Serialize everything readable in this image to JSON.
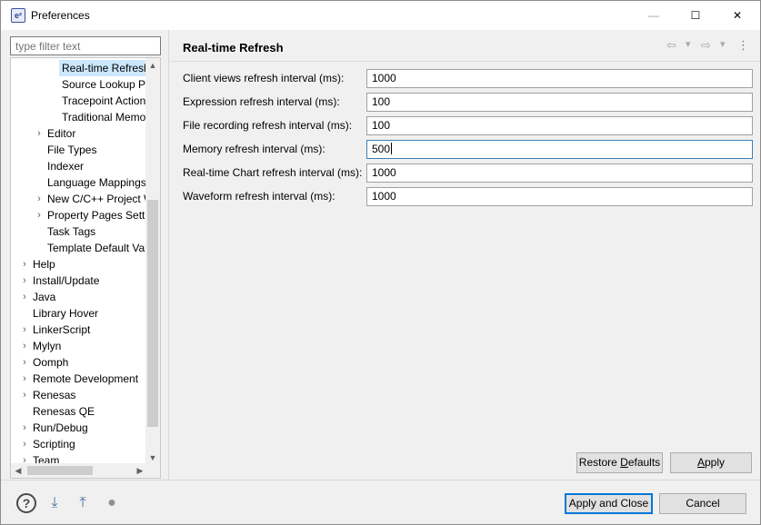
{
  "window": {
    "title": "Preferences",
    "app_icon_glyph": "e²",
    "minimize_glyph": "—",
    "maximize_glyph": "☐",
    "close_glyph": "✕"
  },
  "filter": {
    "placeholder": "type filter text"
  },
  "tree": {
    "expand_glyph": "›",
    "items": [
      {
        "label": "Real-time Refresh",
        "level": 3,
        "expandable": false,
        "selected": true
      },
      {
        "label": "Source Lookup Pa",
        "level": 3,
        "expandable": false,
        "selected": false
      },
      {
        "label": "Tracepoint Actions",
        "level": 3,
        "expandable": false,
        "selected": false
      },
      {
        "label": "Traditional Memor",
        "level": 3,
        "expandable": false,
        "selected": false
      },
      {
        "label": "Editor",
        "level": 2,
        "expandable": true,
        "selected": false
      },
      {
        "label": "File Types",
        "level": 2,
        "expandable": false,
        "selected": false
      },
      {
        "label": "Indexer",
        "level": 2,
        "expandable": false,
        "selected": false
      },
      {
        "label": "Language Mappings",
        "level": 2,
        "expandable": false,
        "selected": false
      },
      {
        "label": "New C/C++ Project W",
        "level": 2,
        "expandable": true,
        "selected": false
      },
      {
        "label": "Property Pages Settin",
        "level": 2,
        "expandable": true,
        "selected": false
      },
      {
        "label": "Task Tags",
        "level": 2,
        "expandable": false,
        "selected": false
      },
      {
        "label": "Template Default Valu",
        "level": 2,
        "expandable": false,
        "selected": false
      },
      {
        "label": "Help",
        "level": 1,
        "expandable": true,
        "selected": false
      },
      {
        "label": "Install/Update",
        "level": 1,
        "expandable": true,
        "selected": false
      },
      {
        "label": "Java",
        "level": 1,
        "expandable": true,
        "selected": false
      },
      {
        "label": "Library Hover",
        "level": 1,
        "expandable": false,
        "selected": false
      },
      {
        "label": "LinkerScript",
        "level": 1,
        "expandable": true,
        "selected": false
      },
      {
        "label": "Mylyn",
        "level": 1,
        "expandable": true,
        "selected": false
      },
      {
        "label": "Oomph",
        "level": 1,
        "expandable": true,
        "selected": false
      },
      {
        "label": "Remote Development",
        "level": 1,
        "expandable": true,
        "selected": false
      },
      {
        "label": "Renesas",
        "level": 1,
        "expandable": true,
        "selected": false
      },
      {
        "label": "Renesas QE",
        "level": 1,
        "expandable": false,
        "selected": false
      },
      {
        "label": "Run/Debug",
        "level": 1,
        "expandable": true,
        "selected": false
      },
      {
        "label": "Scripting",
        "level": 1,
        "expandable": true,
        "selected": false
      },
      {
        "label": "Team",
        "level": 1,
        "expandable": true,
        "selected": false
      }
    ],
    "scroll_up_glyph": "▲",
    "scroll_down_glyph": "▼",
    "scroll_left_glyph": "◀",
    "scroll_right_glyph": "▶"
  },
  "page": {
    "title": "Real-time Refresh",
    "nav_back_glyph": "⇦",
    "nav_forward_glyph": "⇨",
    "nav_dropdown_glyph": "▾",
    "nav_menu_glyph": "⋮",
    "fields": [
      {
        "label": "Client views refresh interval (ms):",
        "value": "1000",
        "focused": false
      },
      {
        "label": "Expression refresh interval (ms):",
        "value": "100",
        "focused": false
      },
      {
        "label": "File recording refresh interval (ms):",
        "value": "100",
        "focused": false
      },
      {
        "label": "Memory refresh interval (ms):",
        "value": "500",
        "focused": true
      },
      {
        "label": "Real-time Chart refresh interval (ms):",
        "value": "1000",
        "focused": false
      },
      {
        "label": "Waveform refresh interval (ms):",
        "value": "1000",
        "focused": false
      }
    ],
    "restore_defaults": {
      "before": "Restore ",
      "mnemonic": "D",
      "after": "efaults"
    },
    "apply": {
      "before": "",
      "mnemonic": "A",
      "after": "pply"
    }
  },
  "footer": {
    "help_glyph": "?",
    "import_glyph": "⤓",
    "export_glyph": "⤒",
    "record_glyph": "●",
    "apply_and_close": "Apply and Close",
    "cancel": "Cancel"
  }
}
